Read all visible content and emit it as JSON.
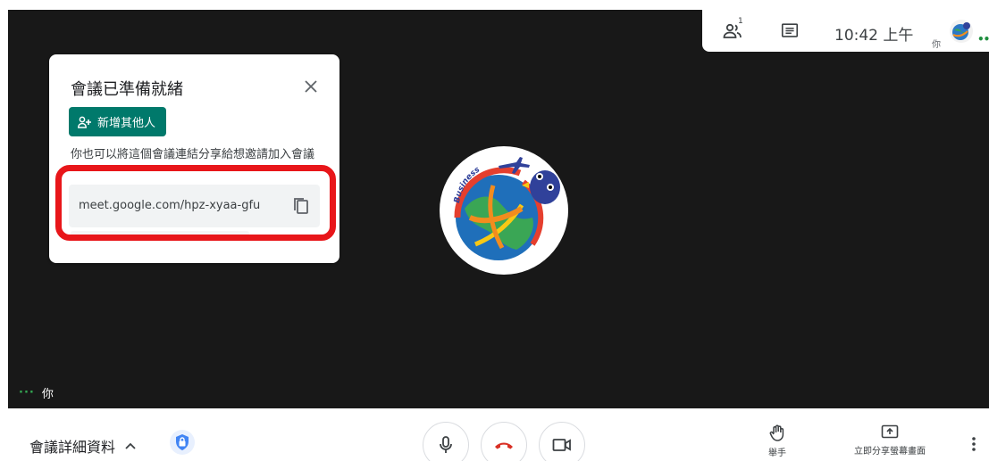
{
  "topbar": {
    "time": "10:42 上午",
    "self_short": "你",
    "participants_badge": "1"
  },
  "card": {
    "title": "會議已準備就緒",
    "add_button_label": "新增其他人",
    "description": "你也可以將這個會議連結分享給想邀請加入會議",
    "meeting_link": "meet.google.com/hpz-xyaa-gfu"
  },
  "stage": {
    "self_label": "你",
    "avatar_text": "Business"
  },
  "bottombar": {
    "details_label": "會議詳細資料",
    "raise_hand_label": "舉手",
    "share_screen_label": "立即分享螢幕畫面"
  },
  "colors": {
    "accent_green": "#00796b",
    "highlight_red": "#e8161a",
    "hangup_red": "#d93025",
    "stage_bg": "#181818"
  }
}
